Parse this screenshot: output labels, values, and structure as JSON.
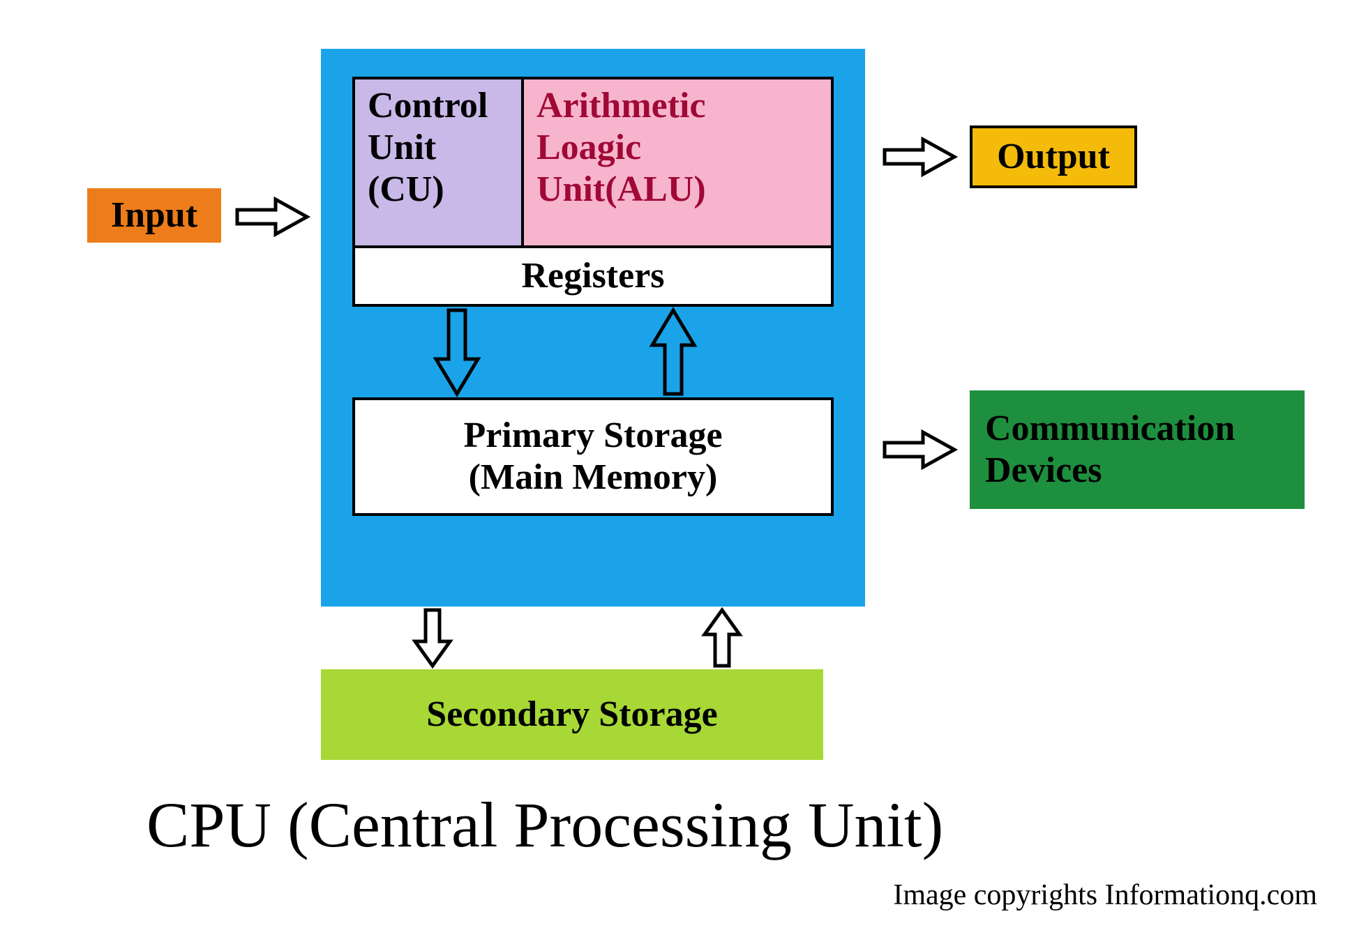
{
  "boxes": {
    "input": "Input",
    "cu": "Control\nUnit\n(CU)",
    "alu": "Arithmetic\nLoagic\nUnit(ALU)",
    "registers": "Registers",
    "primary": "Primary Storage\n(Main Memory)",
    "output": "Output",
    "communication": "Communication\nDevices",
    "secondary": "Secondary Storage"
  },
  "title": "CPU (Central Processing Unit)",
  "credit": "Image  copyrights Informationq.com",
  "colors": {
    "cpu_bg": "#1aa3e8",
    "input_bg": "#ed7d1a",
    "output_bg": "#f5bb0a",
    "comm_bg": "#1e8f3e",
    "secondary_bg": "#a7d836",
    "cu_bg": "#c8b9e9",
    "alu_bg": "#f7b5cd",
    "alu_text": "#a00836",
    "arrow_fill_blue": "#1aa3e8"
  }
}
